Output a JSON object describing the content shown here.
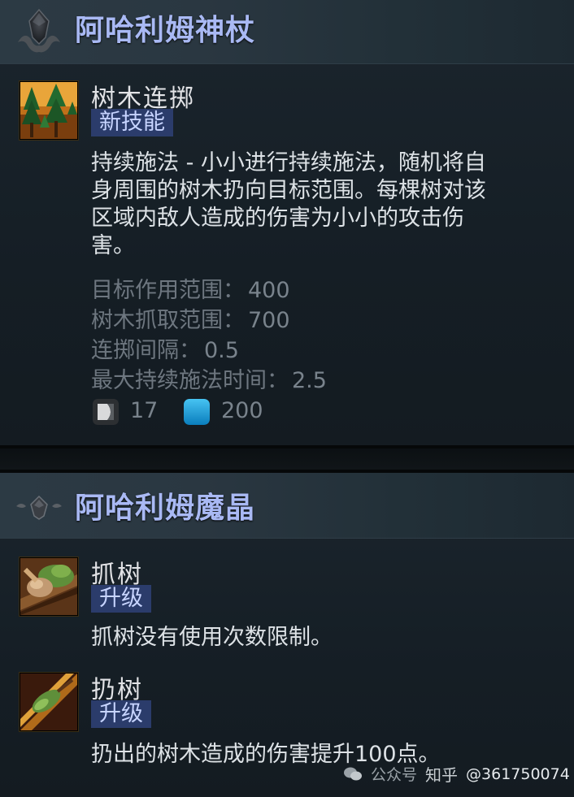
{
  "scepter": {
    "title": "阿哈利姆神杖",
    "ability": {
      "name": "树木连掷",
      "tag": "新技能",
      "description": "持续施法 - 小小进行持续施法，随机将自身周围的树木扔向目标范围。每棵树对该区域内敌人造成的伤害为小小的攻击伤害。",
      "description_lines": [
        "持续施法 - 小小进行持续施法，随机将自",
        "身周围的树木扔向目标范围。每棵树对该",
        "区域内敌人造成的伤害为小小的攻击伤",
        "害。"
      ],
      "stats": [
        {
          "label": "目标作用范围：",
          "value": "400"
        },
        {
          "label": "树木抓取范围：",
          "value": "700"
        },
        {
          "label": "连掷间隔：",
          "value": "0.5"
        },
        {
          "label": "最大持续施法时间：",
          "value": "2.5"
        }
      ],
      "cooldown": "17",
      "mana": "200"
    }
  },
  "shard": {
    "title": "阿哈利姆魔晶",
    "abilities": [
      {
        "name": "抓树",
        "tag": "升级",
        "description": "抓树没有使用次数限制。"
      },
      {
        "name": "扔树",
        "tag": "升级",
        "description": "扔出的树木造成的伤害提升100点。"
      }
    ]
  },
  "watermark": {
    "platform": "公众号",
    "site": "知乎",
    "handle": "@361750074"
  },
  "icons": {
    "scepter_emblem": "aghanims-scepter-icon",
    "shard_emblem": "aghanims-shard-icon",
    "cooldown": "cooldown-icon",
    "mana": "mana-icon"
  },
  "colors": {
    "title": "#a9b9f4",
    "tag_bg": "#2b3c6b",
    "tag_text": "#c7d4ff",
    "mana": "#1fa7e0"
  }
}
